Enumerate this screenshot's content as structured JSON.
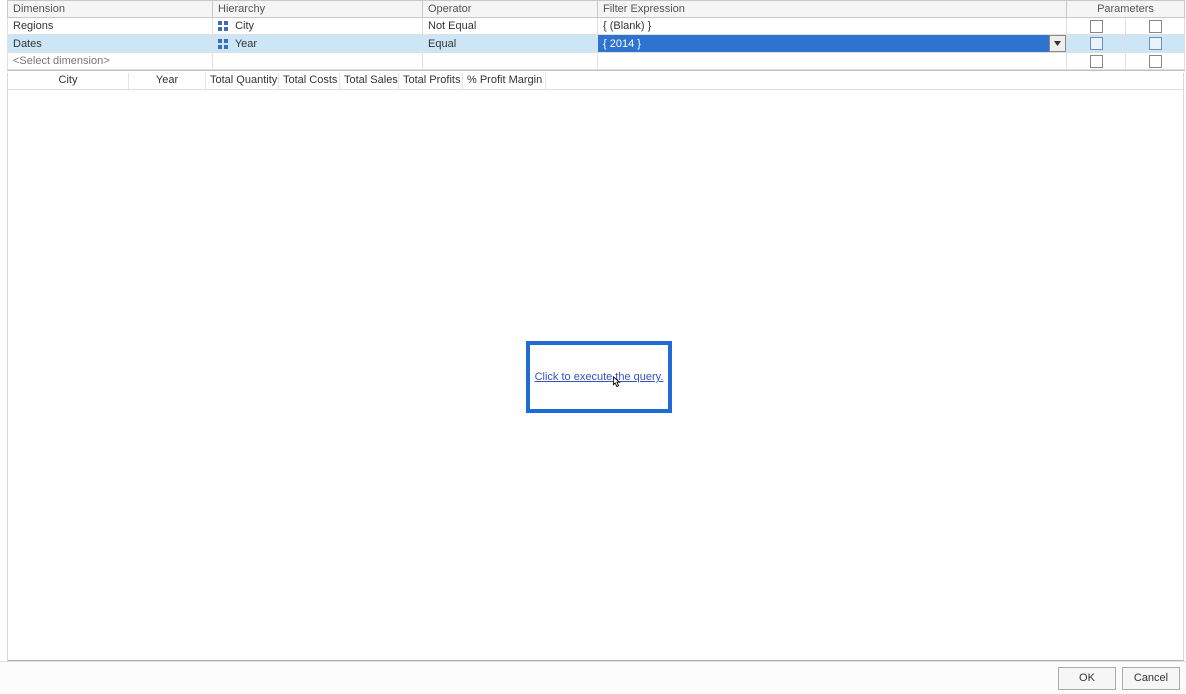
{
  "filter_headers": {
    "dimension": "Dimension",
    "hierarchy": "Hierarchy",
    "operator": "Operator",
    "filter_expression": "Filter Expression",
    "parameters": "Parameters"
  },
  "filter_rows": [
    {
      "dimension": "Regions",
      "hierarchy": "City",
      "operator": "Not Equal",
      "filter_expression": "{ (Blank) }"
    },
    {
      "dimension": "Dates",
      "hierarchy": "Year",
      "operator": "Equal",
      "filter_expression": "{ 2014 }"
    }
  ],
  "placeholder_row": "<Select dimension>",
  "result_columns": [
    "City",
    "Year",
    "Total Quantity",
    "Total Costs",
    "Total Sales",
    "Total Profits",
    "% Profit Margin"
  ],
  "execute_link": "Click to execute the query.",
  "buttons": {
    "ok": "OK",
    "cancel": "Cancel"
  }
}
